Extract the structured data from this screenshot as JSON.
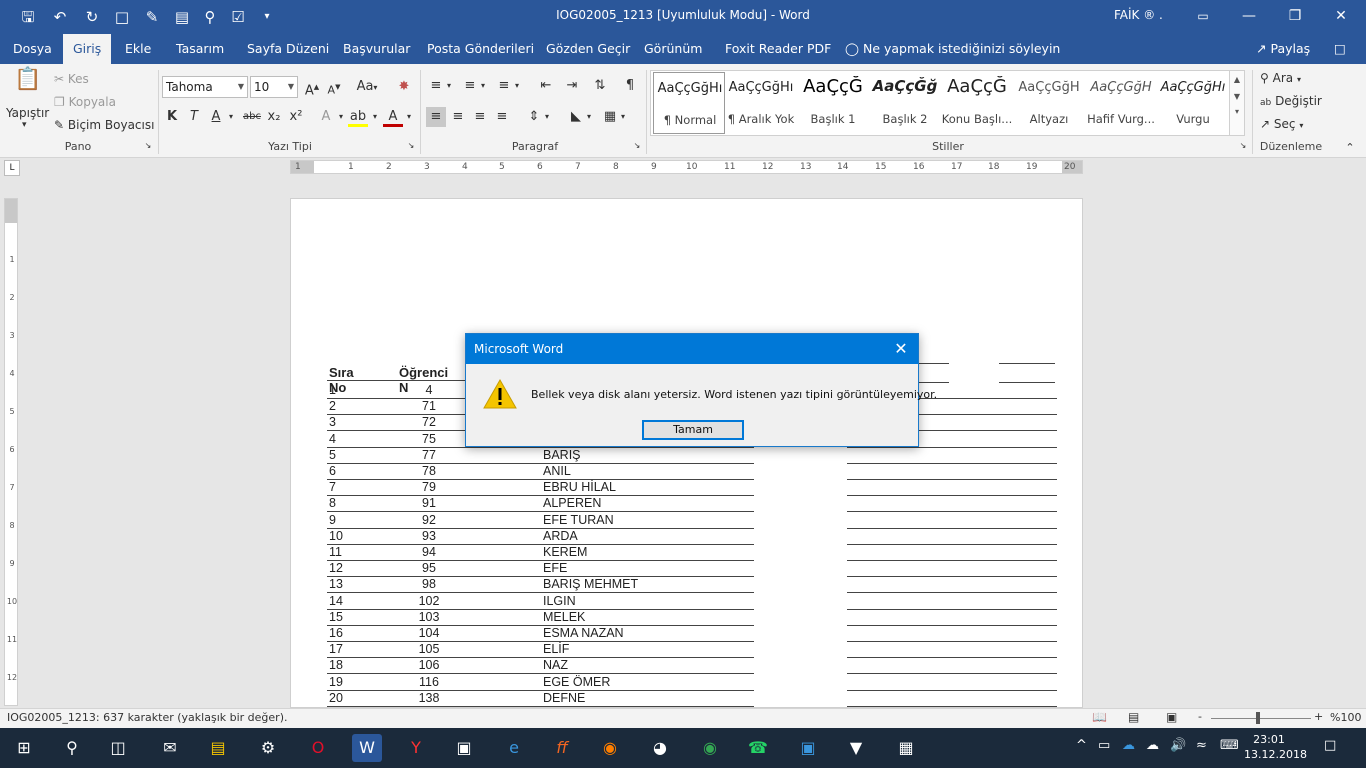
{
  "window": {
    "title": "IOG02005_1213 [Uyumluluk Modu]  -  Word",
    "user": "FAİK ® .",
    "minimize": "—",
    "restore": "❐",
    "close": "✕"
  },
  "quick_access": [
    "save-icon",
    "undo-icon",
    "redo-icon",
    "new-doc-icon",
    "open-icon",
    "print-preview-icon",
    "edit-icon",
    "customize-icon"
  ],
  "tabs": [
    {
      "label": "Dosya"
    },
    {
      "label": "Giriş"
    },
    {
      "label": "Ekle"
    },
    {
      "label": "Tasarım"
    },
    {
      "label": "Sayfa Düzeni"
    },
    {
      "label": "Başvurular"
    },
    {
      "label": "Posta Gönderileri"
    },
    {
      "label": "Gözden Geçir"
    },
    {
      "label": "Görünüm"
    },
    {
      "label": "Foxit Reader PDF"
    },
    {
      "label": "Ne yapmak istediğinizi söyleyin"
    }
  ],
  "share_label": "Paylaş",
  "ribbon": {
    "clipboard": {
      "paste": "Yapıştır",
      "cut": "Kes",
      "copy": "Kopyala",
      "format_painter": "Biçim Boyacısı",
      "group": "Pano"
    },
    "font": {
      "name": "Tahoma",
      "size": "10",
      "case": "Aa",
      "bold": "K",
      "italic": "T",
      "underline": "A",
      "strike": "abc",
      "subscript": "x₂",
      "superscript": "x²",
      "group": "Yazı Tipi"
    },
    "paragraph": {
      "group": "Paragraf"
    },
    "styles": {
      "group": "Stiller",
      "items": [
        {
          "sample": "AaÇçĞğHı",
          "name": "¶ Normal"
        },
        {
          "sample": "AaÇçĞğHı",
          "name": "¶ Aralık Yok"
        },
        {
          "sample": "AaÇçĞ",
          "name": "Başlık 1"
        },
        {
          "sample": "AaÇçĞğ",
          "name": "Başlık 2"
        },
        {
          "sample": "AaÇçĞ",
          "name": "Konu Başlı..."
        },
        {
          "sample": "AaÇçĞğH",
          "name": "Altyazı"
        },
        {
          "sample": "AaÇçĞğH",
          "name": "Hafif Vurg..."
        },
        {
          "sample": "AaÇçĞğHı",
          "name": "Vurgu"
        }
      ]
    },
    "editing": {
      "find": "Ara",
      "replace": "Değiştir",
      "select": "Seç",
      "group": "Düzenleme"
    }
  },
  "ruler": {
    "numbers": [
      "1",
      "1",
      "2",
      "3",
      "4",
      "5",
      "6",
      "7",
      "8",
      "9",
      "10",
      "11",
      "12",
      "13",
      "14",
      "15",
      "16",
      "17",
      "18",
      "19",
      "20"
    ],
    "vnumbers": [
      "1",
      "2",
      "3",
      "4",
      "5",
      "6",
      "7",
      "8",
      "9",
      "10",
      "11",
      "12"
    ],
    "corner": "L"
  },
  "document": {
    "headers": {
      "c1": "Sıra No",
      "c2": "Öğrenci N"
    },
    "rows": [
      {
        "no": "1",
        "num": "4",
        "name": ""
      },
      {
        "no": "2",
        "num": "71",
        "name": ""
      },
      {
        "no": "3",
        "num": "72",
        "name": ""
      },
      {
        "no": "4",
        "num": "75",
        "name": ""
      },
      {
        "no": "5",
        "num": "77",
        "name": "BARIŞ"
      },
      {
        "no": "6",
        "num": "78",
        "name": "ANIL"
      },
      {
        "no": "7",
        "num": "79",
        "name": "EBRU HİLAL"
      },
      {
        "no": "8",
        "num": "91",
        "name": "ALPEREN"
      },
      {
        "no": "9",
        "num": "92",
        "name": "EFE TURAN"
      },
      {
        "no": "10",
        "num": "93",
        "name": "ARDA"
      },
      {
        "no": "11",
        "num": "94",
        "name": "KEREM"
      },
      {
        "no": "12",
        "num": "95",
        "name": "EFE"
      },
      {
        "no": "13",
        "num": "98",
        "name": "BARIŞ MEHMET"
      },
      {
        "no": "14",
        "num": "102",
        "name": "ILGIN"
      },
      {
        "no": "15",
        "num": "103",
        "name": "MELEK"
      },
      {
        "no": "16",
        "num": "104",
        "name": "ESMA NAZAN"
      },
      {
        "no": "17",
        "num": "105",
        "name": "ELİF"
      },
      {
        "no": "18",
        "num": "106",
        "name": "NAZ"
      },
      {
        "no": "19",
        "num": "116",
        "name": "EGE ÖMER"
      },
      {
        "no": "20",
        "num": "138",
        "name": "DEFNE"
      }
    ]
  },
  "dialog": {
    "title": "Microsoft Word",
    "message": "Bellek veya disk alanı yetersiz. Word istenen yazı tipini görüntüleyemiyor.",
    "ok": "Tamam",
    "close": "✕"
  },
  "statusbar": {
    "text": "IOG02005_1213: 637 karakter (yaklaşık bir değer).",
    "zoom": "%100",
    "minus": "-",
    "plus": "+"
  },
  "taskbar": {
    "time": "23:01",
    "date": "13.12.2018",
    "apps": [
      "start-icon",
      "search-icon",
      "task-view-icon",
      "mail-icon",
      "file-explorer-icon",
      "settings-icon",
      "opera-icon",
      "word-icon",
      "yandex-icon",
      "store-icon",
      "edge-icon",
      "foxit-icon",
      "firefox-icon",
      "speed-icon",
      "chrome-icon",
      "whatsapp-icon",
      "remote-icon",
      "fox-icon",
      "calculator-icon"
    ]
  },
  "colors": {
    "word_blue": "#2b579a",
    "dialog_blue": "#0078d7",
    "taskbar": "#1b2a3b"
  }
}
